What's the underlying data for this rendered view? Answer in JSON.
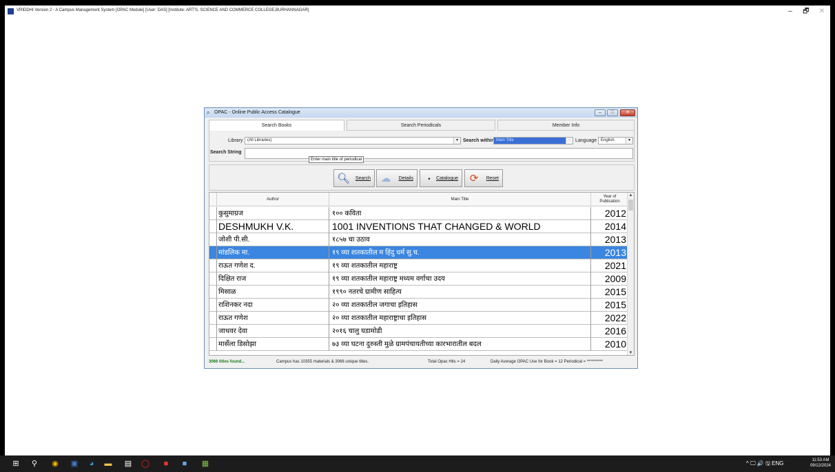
{
  "window": {
    "title": "VRIDDHI Version 2 - A Campus Management System [OPAC Module] [User: DAS] [Institute: ART'S, SCIENCE AND COMMERCE COLLEGE,BURHANNAGAR]",
    "min": "–",
    "max": "🗗",
    "close": "✕"
  },
  "dialog": {
    "title": "OPAC - Online Public Access Catalogue",
    "tabs": [
      "Search Books",
      "Search Periodicals",
      "Member Info"
    ],
    "library_label": "Library",
    "library_value": "(All Libraries)",
    "search_within_label": "Search within",
    "search_within_value": "Main Title",
    "language_label": "Language",
    "language_value": "English",
    "search_string_label": "Search String",
    "tooltip": "Enter main title of periodical",
    "buttons": {
      "search": "Search",
      "details": "Details",
      "catalogue": "Catalogue",
      "reset": "Reset"
    },
    "grid": {
      "headers": {
        "author": "Author",
        "title": "Main Title",
        "year_line1": "Year of",
        "year_line2": "Publication"
      },
      "rows": [
        {
          "author": "कुसुमाग्रज",
          "title": "१०० कविता",
          "year": "2012"
        },
        {
          "author": "DESHMUKH V.K.",
          "title": "1001 INVENTIONS THAT CHANGED & WORLD",
          "year": "2014"
        },
        {
          "author": "जोशी पी.सी.",
          "title": "१८५७ चा उठाव",
          "year": "2013"
        },
        {
          "author": "मांडलिक मा.",
          "title": "१९ व्या शतकातील म हिंदु धर्म सु.च.",
          "year": "2013"
        },
        {
          "author": "राऊत गणेश द.",
          "title": "१९ व्या शतकातील महाराष्ट्र",
          "year": "2021"
        },
        {
          "author": "दिक्षित राज",
          "title": "१९ व्या शतकातील महाराष्ट्र मध्यम वर्गाचा उदय",
          "year": "2009"
        },
        {
          "author": "मिसाळ",
          "title": "१९९० नतरचे ग्रामीण साहित्य",
          "year": "2015"
        },
        {
          "author": "राशिनकर नदा",
          "title": "२० व्या शतकातील जगाचा इतिहास",
          "year": "2015"
        },
        {
          "author": "राऊत गणेश",
          "title": "२० व्या शतकातील महाराष्ट्राचा इतिहास",
          "year": "2022"
        },
        {
          "author": "जाधवर देवा",
          "title": "२०१६ चालु घडामोडी",
          "year": "2016"
        },
        {
          "author": "मार्सेला डिसोझा",
          "title": "७३ व्या घटना दुरुस्ती मुळे ग्रामपंचायतीच्या कारभारातील बदल",
          "year": "2010"
        }
      ]
    },
    "status": {
      "found": "3066 titles found...",
      "campus": "Campus has 10355 materials & 3066 unique titles.",
      "hits": "Total Opac Hits = 24",
      "daily": "Daily Average OPAC Use for Book = 12 Periodical = **********"
    }
  },
  "taskbar": {
    "tray": "^ 🖵 🔊 🖫 ENG",
    "time": "11:53 AM",
    "date": "09/12/2024"
  }
}
